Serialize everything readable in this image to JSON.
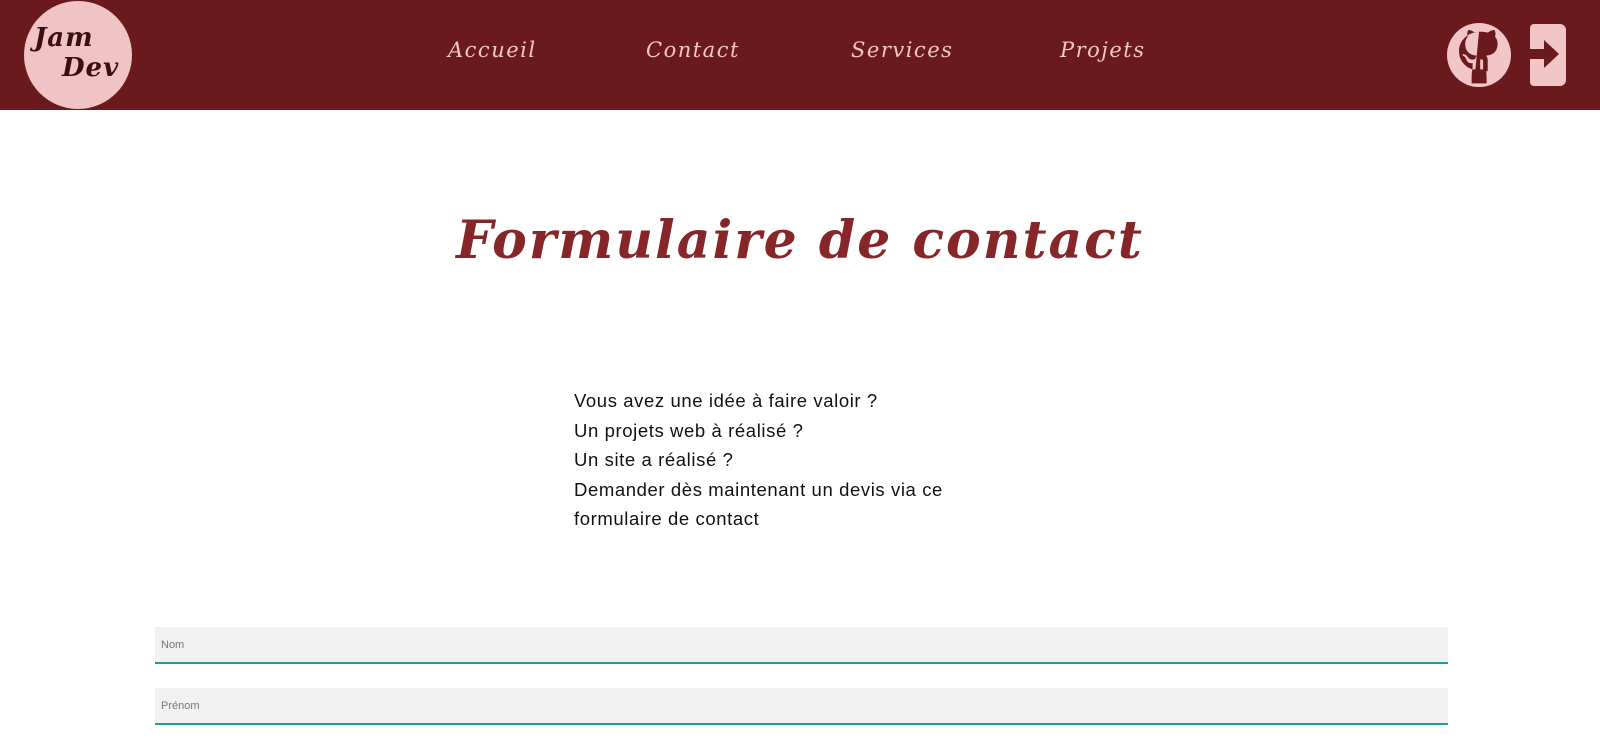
{
  "colors": {
    "navbar_bg": "#6a1a1c",
    "accent_pink": "#f2c6c6",
    "title_color": "#862629",
    "field_underline": "#1f9c9a",
    "field_bg": "#f1f1f1"
  },
  "header": {
    "logo_line1": "Jam",
    "logo_line2": "Dev",
    "nav": [
      {
        "label": "Accueil"
      },
      {
        "label": "Contact"
      },
      {
        "label": "Services"
      },
      {
        "label": "Projets"
      }
    ],
    "icons": [
      "github-icon",
      "login-icon"
    ]
  },
  "main": {
    "title": "Formulaire de contact",
    "intro_lines": [
      "Vous avez une idée à faire valoir ?",
      "Un projets web à réalisé ?",
      "Un site a réalisé ?",
      "Demander dès maintenant un devis via ce",
      "formulaire de contact"
    ],
    "form": {
      "nom_placeholder": "Nom",
      "nom_value": "",
      "prenom_placeholder": "Prénom",
      "prenom_value": ""
    }
  }
}
